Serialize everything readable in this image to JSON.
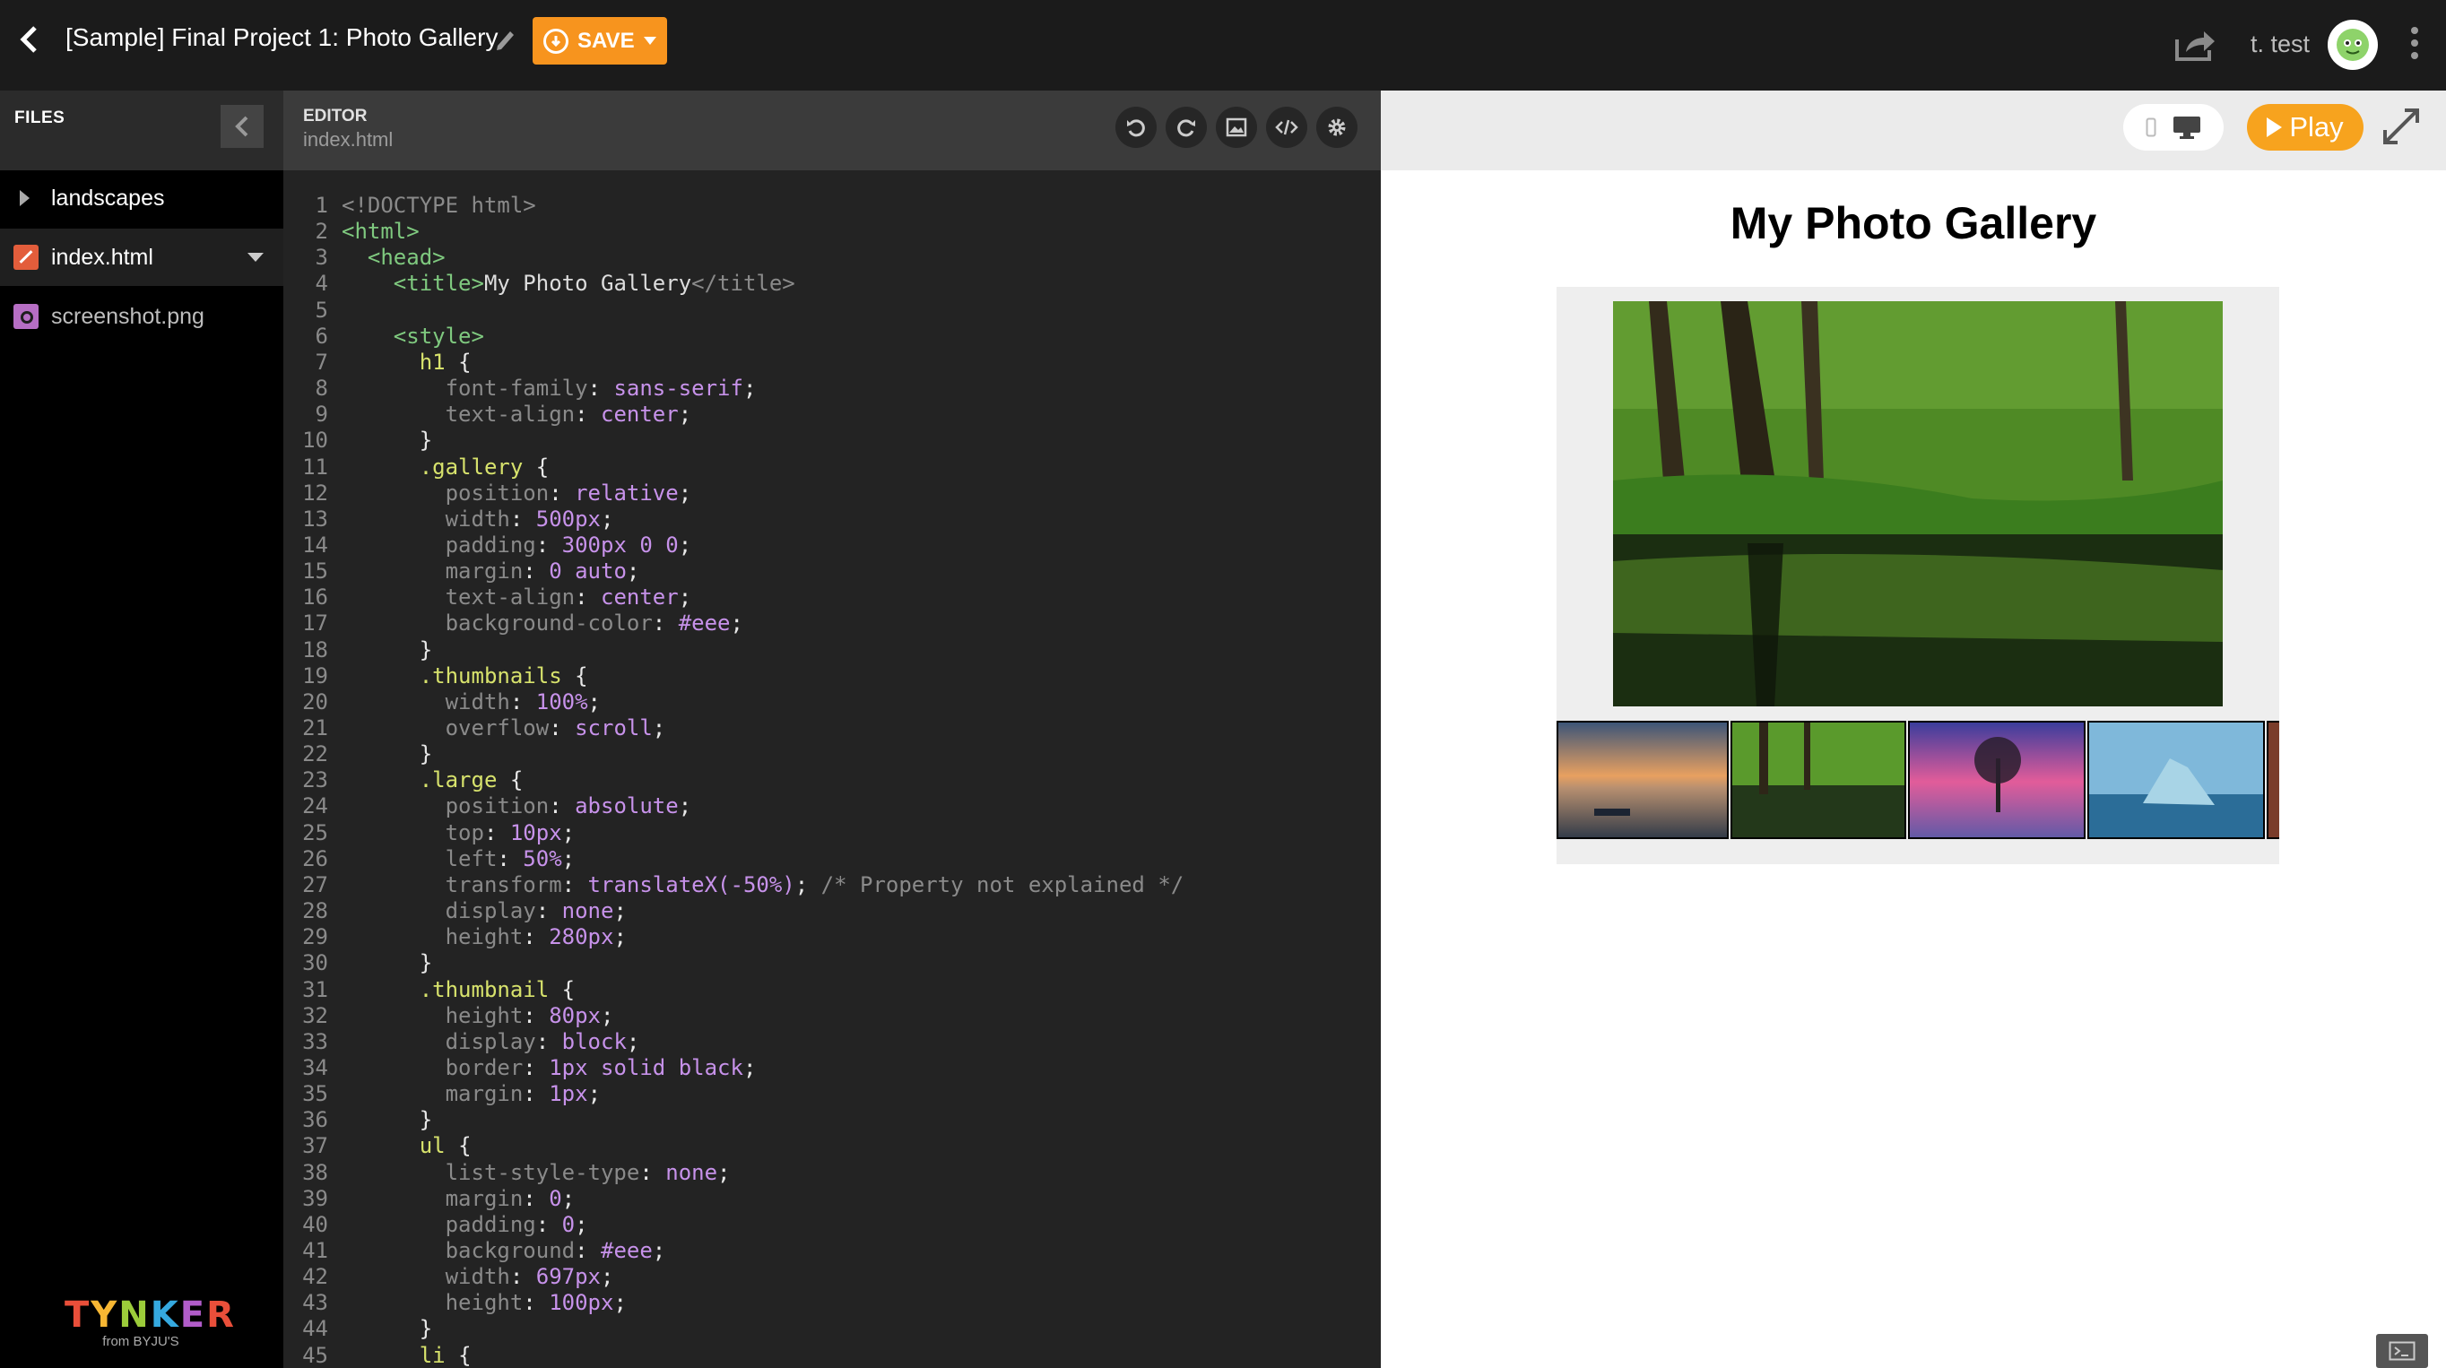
{
  "header": {
    "project_title": "[Sample] Final Project 1: Photo Gallery",
    "save_label": "SAVE",
    "username": "t. test"
  },
  "files": {
    "title": "FILES",
    "items": [
      {
        "label": "landscapes",
        "type": "folder"
      },
      {
        "label": "index.html",
        "type": "html"
      },
      {
        "label": "screenshot.png",
        "type": "image"
      }
    ]
  },
  "branding": {
    "logo_text": "TYNKER",
    "logo_sub": "from BYJU'S"
  },
  "editor": {
    "title": "EDITOR",
    "filename": "index.html",
    "lines": [
      "<!DOCTYPE html>",
      "<html>",
      "  <head>",
      "    <title>My Photo Gallery</title>",
      "",
      "    <style>",
      "      h1 {",
      "        font-family: sans-serif;",
      "        text-align: center;",
      "      }",
      "      .gallery {",
      "        position: relative;",
      "        width: 500px;",
      "        padding: 300px 0 0;",
      "        margin: 0 auto;",
      "        text-align: center;",
      "        background-color: #eee;",
      "      }",
      "      .thumbnails {",
      "        width: 100%;",
      "        overflow: scroll;",
      "      }",
      "      .large {",
      "        position: absolute;",
      "        top: 10px;",
      "        left: 50%;",
      "        transform: translateX(-50%); /* Property not explained */",
      "        display: none;",
      "        height: 280px;",
      "      }",
      "      .thumbnail {",
      "        height: 80px;",
      "        display: block;",
      "        border: 1px solid black;",
      "        margin: 1px;",
      "      }",
      "      ul {",
      "        list-style-type: none;",
      "        margin: 0;",
      "        padding: 0;",
      "        background: #eee;",
      "        width: 697px;",
      "        height: 100px;",
      "      }",
      "      li {"
    ]
  },
  "preview": {
    "play_label": "Play",
    "page_title": "My Photo Gallery"
  },
  "colors": {
    "accent": "#f7941e",
    "play": "#f7a31e",
    "topbar": "#1b1b1b",
    "editor_bg": "#232323"
  }
}
